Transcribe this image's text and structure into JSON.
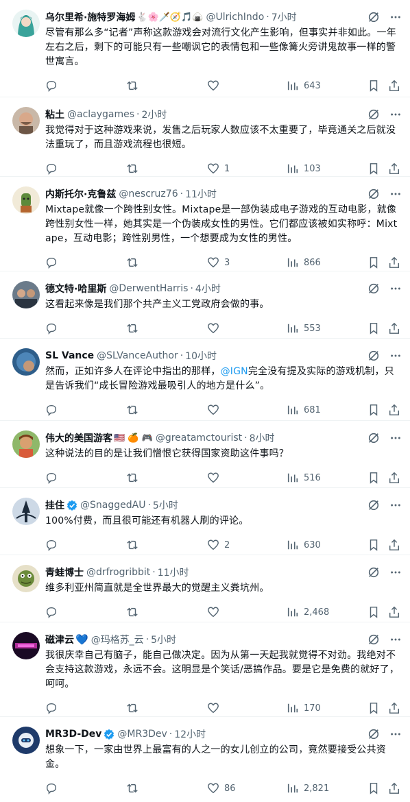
{
  "tweets": [
    {
      "name": "乌尔里希·施特罗海姆",
      "emoji": "🐇🌸🗡️🧭🎵🍙",
      "handle": "@UlrichIndo",
      "time": "7小时",
      "text": "尽管有那么多“记者”声称这款游戏会对流行文化产生影响，但事实并非如此。一年左右之后，剩下的可能只有一些嘲讽它的表情包和一些像篝火旁讲鬼故事一样的警世寓言。",
      "replies": "",
      "retweets": "",
      "likes": "",
      "views": "643",
      "avatar_color": "#3aa39a"
    },
    {
      "name": "粘土",
      "handle": "@aclaygames",
      "time": "2小时",
      "text": "我觉得对于这种游戏来说，发售之后玩家人数应该不太重要了，毕竟通关之后就没法重玩了，而且游戏流程也很短。",
      "replies": "",
      "retweets": "",
      "likes": "1",
      "views": "103",
      "avatar_color": "#7a5c48"
    },
    {
      "name": "内斯托尔·克鲁兹",
      "handle": "@nescruz76",
      "time": "11小时",
      "text": "Mixtape就像一个跨性别女性。Mixtape是一部伪装成电子游戏的互动电影，就像跨性别女性一样，她其实是一个伪装成女性的男性。它们都应该被如实称呼：Mixtape，互动电影；跨性别男性，一个想要成为女性的男性。",
      "replies": "",
      "retweets": "",
      "likes": "3",
      "views": "866",
      "avatar_color": "#c4a24a"
    },
    {
      "name": "德文特·哈里斯",
      "handle": "@DerwentHarris",
      "time": "4小时",
      "text": "这看起来像是我们那个共产主义工党政府会做的事。",
      "replies": "",
      "retweets": "",
      "likes": "",
      "views": "553",
      "avatar_color": "#4a5a6a"
    },
    {
      "name": "SL Vance",
      "handle": "@SLVanceAuthor",
      "time": "10小时",
      "text_pre": "然而，正如许多人在评论中指出的那样，",
      "text_link": "@IGN",
      "text_post": "完全没有提及实际的游戏机制，只是告诉我们“成长冒险游戏最吸引人的地方是什么”。",
      "replies": "",
      "retweets": "",
      "likes": "",
      "views": "681",
      "avatar_color": "#3b6fa0"
    },
    {
      "name": "伟大的美国游客",
      "emoji": "🇺🇸 🍊 🎮",
      "handle": "@greatamctourist",
      "time": "8小时",
      "text": "这种说法的目的是让我们憎恨它获得国家资助这件事吗？",
      "replies": "",
      "retweets": "",
      "likes": "",
      "views": "516",
      "avatar_color": "#5a8a4a"
    },
    {
      "name": "挂住",
      "handle": "@SnaggedAU",
      "time": "5小时",
      "text": "100%付费，而且很可能还有机器人刷的评论。",
      "replies": "",
      "retweets": "",
      "likes": "2",
      "views": "630",
      "avatar_color": "#2c3e56"
    },
    {
      "name": "青蛙博士",
      "handle": "@drfrogribbit",
      "time": "11小时",
      "text": "维多利亚州简直就是全世界最大的觉醒主义粪坑州。",
      "replies": "",
      "retweets": "",
      "likes": "",
      "views": "2,468",
      "avatar_color": "#8a9a4a"
    },
    {
      "name": "磁津云",
      "emoji": "💙",
      "handle": "@玛格苏_云",
      "time": "5小时",
      "text": "我很庆幸自己有脑子，能自己做决定。因为从第一天起我就觉得不对劲。我绝对不会支持这款游戏，永远不会。这明显是个笑话/恶搞作品。要是它是免费的就好了，呵呵。",
      "replies": "",
      "retweets": "",
      "likes": "",
      "views": "170",
      "avatar_color": "#3a1a4a"
    },
    {
      "name": "MR3D-Dev",
      "handle": "@MR3Dev",
      "time": "12小时",
      "text": "想象一下，一家由世界上最富有的人之一的女儿创立的公司，竟然要接受公共资金。",
      "replies": "",
      "retweets": "",
      "likes": "86",
      "views": "2,821",
      "avatar_color": "#1e3a6a"
    }
  ]
}
